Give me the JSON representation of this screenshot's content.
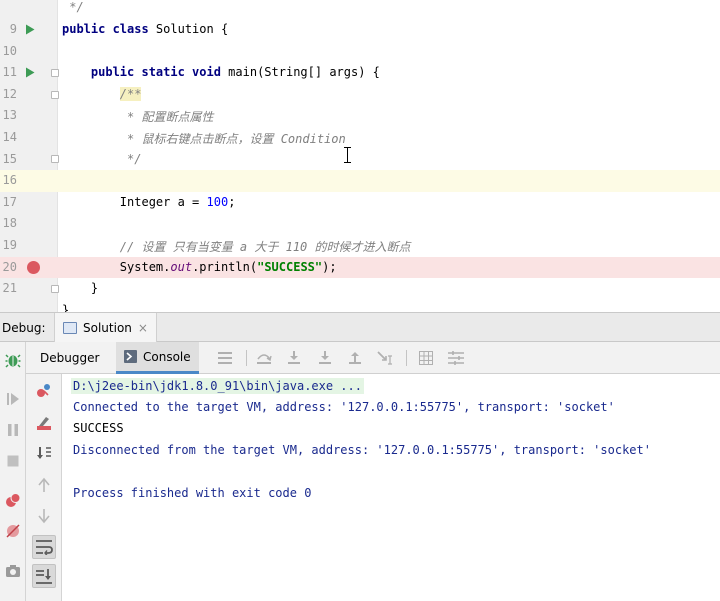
{
  "editor": {
    "lines": [
      {
        "num": "",
        "segments": [
          {
            "t": " */",
            "c": "cm"
          }
        ]
      },
      {
        "num": "9",
        "run": true,
        "segments": [
          {
            "t": "public class ",
            "c": "kw"
          },
          {
            "t": "Solution {",
            "c": "var"
          }
        ]
      },
      {
        "num": "10",
        "segments": []
      },
      {
        "num": "11",
        "run": true,
        "fold": true,
        "segments": [
          {
            "t": "    public static void ",
            "c": "kw"
          },
          {
            "t": "main(String[] args) {",
            "c": "var"
          }
        ]
      },
      {
        "num": "12",
        "fold": true,
        "segments": [
          {
            "t": "        ",
            "c": "var"
          },
          {
            "t": "/**",
            "c": "cm doc-hl"
          }
        ]
      },
      {
        "num": "13",
        "segments": [
          {
            "t": "         * 配置断点属性",
            "c": "cm"
          }
        ]
      },
      {
        "num": "14",
        "segments": [
          {
            "t": "         * 鼠标右键点击断点，设置 Condition",
            "c": "cm"
          }
        ]
      },
      {
        "num": "15",
        "fold": true,
        "segments": [
          {
            "t": "         */",
            "c": "cm"
          }
        ]
      },
      {
        "num": "16",
        "current": true,
        "segments": []
      },
      {
        "num": "17",
        "segments": [
          {
            "t": "        Integer a = ",
            "c": "var"
          },
          {
            "t": "100",
            "c": "num"
          },
          {
            "t": ";",
            "c": "var"
          }
        ]
      },
      {
        "num": "18",
        "segments": []
      },
      {
        "num": "19",
        "segments": [
          {
            "t": "        // 设置 只有当变量 a 大于 110 的时候才进入断点",
            "c": "cm"
          }
        ]
      },
      {
        "num": "20",
        "bp": true,
        "segments": [
          {
            "t": "        System.",
            "c": "var"
          },
          {
            "t": "out",
            "c": "fld"
          },
          {
            "t": ".println(",
            "c": "var"
          },
          {
            "t": "\"SUCCESS\"",
            "c": "str"
          },
          {
            "t": ");",
            "c": "var"
          }
        ]
      },
      {
        "num": "21",
        "fold": true,
        "segments": [
          {
            "t": "    }",
            "c": "var"
          }
        ]
      },
      {
        "num": "",
        "segments": [
          {
            "t": "}",
            "c": "var"
          }
        ]
      }
    ]
  },
  "debug": {
    "title": "Debug:",
    "session_tab": "Solution",
    "close_symbol": "×",
    "tabs": {
      "debugger": "Debugger",
      "console": "Console"
    }
  },
  "console": {
    "lines": [
      {
        "text": "D:\\j2ee-bin\\jdk1.8.0_91\\bin\\java.exe ...",
        "kind": "cmd"
      },
      {
        "text": "Connected to the target VM, address: '127.0.0.1:55775', transport: 'socket'",
        "kind": "sys"
      },
      {
        "text": "SUCCESS",
        "kind": "std"
      },
      {
        "text": "Disconnected from the target VM, address: '127.0.0.1:55775', transport: 'socket'",
        "kind": "sys"
      },
      {
        "text": "",
        "kind": "std"
      },
      {
        "text": "Process finished with exit code 0",
        "kind": "sys"
      }
    ]
  },
  "colors": {
    "breakpoint": "#db5860",
    "run_marker": "#3d9b55",
    "current_line": "#fdfbe5",
    "breakpoint_line": "#fae3e3",
    "console_blue": "#1a2a8e"
  },
  "icons": {
    "left_toolbar": [
      "debug-bug-icon",
      "rerun-icon",
      "pause-icon",
      "stop-icon",
      "view-breakpoints-icon",
      "mute-breakpoints-icon",
      "camera-icon"
    ],
    "tabs_toolbar": [
      "menu-icon",
      "step-over-icon",
      "step-into-icon",
      "force-step-into-icon",
      "step-out-icon",
      "run-to-cursor-icon",
      "evaluate-icon",
      "restore-layout-icon"
    ],
    "console_toolbar": [
      "restore-layout-icon",
      "clear-icon",
      "sort-icon",
      "up-arrow-icon",
      "down-arrow-icon",
      "soft-wrap-icon",
      "scroll-to-end-icon"
    ]
  }
}
